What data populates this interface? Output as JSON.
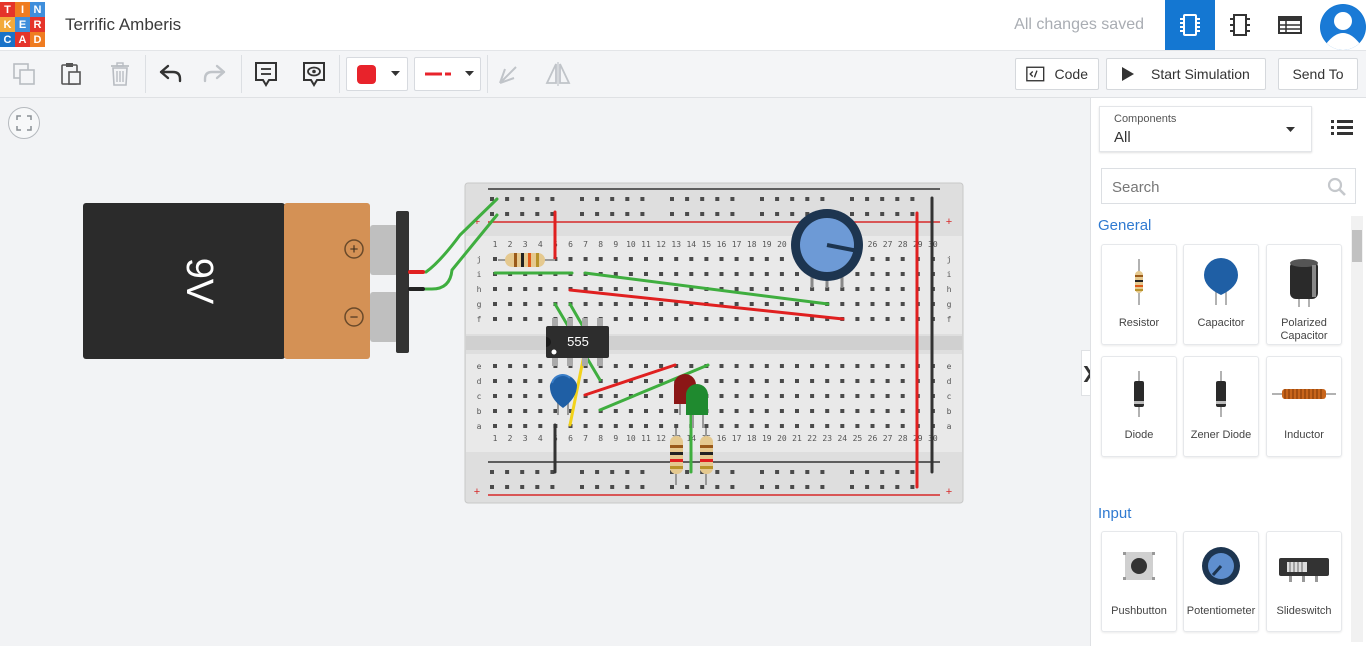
{
  "app": {
    "logo_letters": [
      "T",
      "I",
      "N",
      "K",
      "E",
      "R",
      "C",
      "A",
      "D"
    ],
    "logo_colors": [
      "#e5342a",
      "#ef7c21",
      "#3f8edb",
      "#f2a93b",
      "#3f8edb",
      "#e5342a",
      "#1a73c8",
      "#e5342a",
      "#ef7c21"
    ],
    "design_title": "Terrific Amberis",
    "save_status": "All changes saved"
  },
  "view_buttons": [
    {
      "name": "circuit-view-icon",
      "active": true
    },
    {
      "name": "schematic-view-icon",
      "active": false
    },
    {
      "name": "component-list-view-icon",
      "active": false
    }
  ],
  "toolbar": {
    "color_swatch": "#e8232b",
    "wire_color": "#e8232b",
    "code_label": "Code",
    "simulate_label": "Start Simulation",
    "send_label": "Send To"
  },
  "canvas": {
    "battery_label": "9V",
    "battery_plus": "+",
    "battery_minus": "−",
    "ic_label": "555",
    "breadboard_columns": [
      "1",
      "2",
      "3",
      "4",
      "5",
      "6",
      "7",
      "8",
      "9",
      "10",
      "11",
      "12",
      "13",
      "14",
      "15",
      "16",
      "17",
      "18",
      "19",
      "20",
      "21",
      "22",
      "23",
      "24",
      "25",
      "26",
      "27",
      "28",
      "29",
      "30"
    ],
    "rows_top": [
      "j",
      "i",
      "h",
      "g",
      "f"
    ],
    "rows_bottom": [
      "e",
      "d",
      "c",
      "b",
      "a"
    ]
  },
  "panel": {
    "select_label": "Components",
    "select_value": "All",
    "search_placeholder": "Search",
    "sections": [
      {
        "title": "General",
        "items": [
          {
            "label": "Resistor",
            "icon": "resistor-icon"
          },
          {
            "label": "Capacitor",
            "icon": "capacitor-icon"
          },
          {
            "label": "Polarized Capacitor",
            "icon": "polarized-capacitor-icon"
          },
          {
            "label": "Diode",
            "icon": "diode-icon"
          },
          {
            "label": "Zener Diode",
            "icon": "zener-diode-icon"
          },
          {
            "label": "Inductor",
            "icon": "inductor-icon"
          }
        ]
      },
      {
        "title": "Input",
        "items": [
          {
            "label": "Pushbutton",
            "icon": "pushbutton-icon"
          },
          {
            "label": "Potentiometer",
            "icon": "potentiometer-icon"
          },
          {
            "label": "Slideswitch",
            "icon": "slideswitch-icon"
          }
        ]
      }
    ]
  }
}
